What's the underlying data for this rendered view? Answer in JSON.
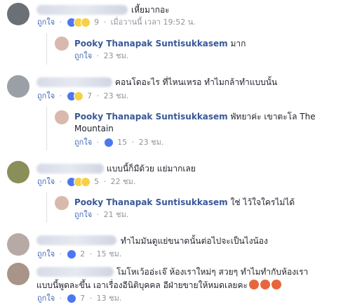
{
  "comments": [
    {
      "text": "เหี้ยมากอะ",
      "like_label": "ถูกใจ",
      "react_count": "9",
      "timestamp": "เมื่อวานนี้ เวลา 19:52 น."
    },
    {
      "reply_author": "Pooky Thanapak Suntisukkasem",
      "reply_text": "มาก",
      "like_label": "ถูกใจ",
      "timestamp": "23 ชม."
    },
    {
      "text": "คอนโดอะไร ที่ไหนเหรอ ทำไมกล้าทำแบบนั้น",
      "like_label": "ถูกใจ",
      "react_count": "7",
      "timestamp": "23 ชม."
    },
    {
      "reply_author": "Pooky Thanapak Suntisukkasem",
      "reply_text_1": "พัทยาค่ะ เขาตะโล The",
      "reply_text_2": "Mountain",
      "like_label": "ถูกใจ",
      "react_count": "15",
      "timestamp": "23 ชม."
    },
    {
      "text": "แบบนี้ก็มีด้วย แย่มากเลย",
      "like_label": "ถูกใจ",
      "react_count": "5",
      "timestamp": "22 ชม."
    },
    {
      "reply_author": "Pooky Thanapak Suntisukkasem",
      "reply_text": "ใช่ ไว้ใจใครไม่ได้",
      "like_label": "ถูกใจ",
      "timestamp": "21 ชม."
    },
    {
      "text": "ทำไมมันดูแย่ขนาดนั้นต่อไปจะเป็นไงน้อง",
      "like_label": "ถูกใจ",
      "react_count": "2",
      "timestamp": "15 ชม."
    },
    {
      "text_1": "โมโหเว้ออ่ะเจ๊ ห้องเราใหม่ๆ สวยๆ ทำไมทำกับห้องเรา",
      "text_2": "แบบนี้พูดละขึ้น เอาเรื่องอีนิติบุคคล อีฝ่ายขายให้หมดเลยคะ",
      "like_label": "ถูกใจ",
      "react_count": "7",
      "timestamp": "13 ชม."
    }
  ],
  "separator": "·",
  "colors": {
    "link": "#385898",
    "like": "#4267b2",
    "meta": "#90949c",
    "angry": "#e8663d"
  }
}
